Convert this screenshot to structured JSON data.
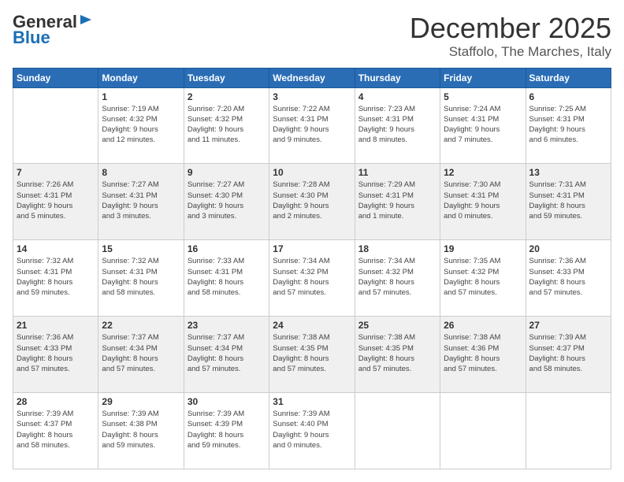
{
  "logo": {
    "general": "General",
    "blue": "Blue"
  },
  "header": {
    "month": "December 2025",
    "location": "Staffolo, The Marches, Italy"
  },
  "weekdays": [
    "Sunday",
    "Monday",
    "Tuesday",
    "Wednesday",
    "Thursday",
    "Friday",
    "Saturday"
  ],
  "weeks": [
    [
      {
        "day": "",
        "detail": ""
      },
      {
        "day": "1",
        "detail": "Sunrise: 7:19 AM\nSunset: 4:32 PM\nDaylight: 9 hours\nand 12 minutes."
      },
      {
        "day": "2",
        "detail": "Sunrise: 7:20 AM\nSunset: 4:32 PM\nDaylight: 9 hours\nand 11 minutes."
      },
      {
        "day": "3",
        "detail": "Sunrise: 7:22 AM\nSunset: 4:31 PM\nDaylight: 9 hours\nand 9 minutes."
      },
      {
        "day": "4",
        "detail": "Sunrise: 7:23 AM\nSunset: 4:31 PM\nDaylight: 9 hours\nand 8 minutes."
      },
      {
        "day": "5",
        "detail": "Sunrise: 7:24 AM\nSunset: 4:31 PM\nDaylight: 9 hours\nand 7 minutes."
      },
      {
        "day": "6",
        "detail": "Sunrise: 7:25 AM\nSunset: 4:31 PM\nDaylight: 9 hours\nand 6 minutes."
      }
    ],
    [
      {
        "day": "7",
        "detail": "Sunrise: 7:26 AM\nSunset: 4:31 PM\nDaylight: 9 hours\nand 5 minutes."
      },
      {
        "day": "8",
        "detail": "Sunrise: 7:27 AM\nSunset: 4:31 PM\nDaylight: 9 hours\nand 3 minutes."
      },
      {
        "day": "9",
        "detail": "Sunrise: 7:27 AM\nSunset: 4:30 PM\nDaylight: 9 hours\nand 3 minutes."
      },
      {
        "day": "10",
        "detail": "Sunrise: 7:28 AM\nSunset: 4:30 PM\nDaylight: 9 hours\nand 2 minutes."
      },
      {
        "day": "11",
        "detail": "Sunrise: 7:29 AM\nSunset: 4:31 PM\nDaylight: 9 hours\nand 1 minute."
      },
      {
        "day": "12",
        "detail": "Sunrise: 7:30 AM\nSunset: 4:31 PM\nDaylight: 9 hours\nand 0 minutes."
      },
      {
        "day": "13",
        "detail": "Sunrise: 7:31 AM\nSunset: 4:31 PM\nDaylight: 8 hours\nand 59 minutes."
      }
    ],
    [
      {
        "day": "14",
        "detail": "Sunrise: 7:32 AM\nSunset: 4:31 PM\nDaylight: 8 hours\nand 59 minutes."
      },
      {
        "day": "15",
        "detail": "Sunrise: 7:32 AM\nSunset: 4:31 PM\nDaylight: 8 hours\nand 58 minutes."
      },
      {
        "day": "16",
        "detail": "Sunrise: 7:33 AM\nSunset: 4:31 PM\nDaylight: 8 hours\nand 58 minutes."
      },
      {
        "day": "17",
        "detail": "Sunrise: 7:34 AM\nSunset: 4:32 PM\nDaylight: 8 hours\nand 57 minutes."
      },
      {
        "day": "18",
        "detail": "Sunrise: 7:34 AM\nSunset: 4:32 PM\nDaylight: 8 hours\nand 57 minutes."
      },
      {
        "day": "19",
        "detail": "Sunrise: 7:35 AM\nSunset: 4:32 PM\nDaylight: 8 hours\nand 57 minutes."
      },
      {
        "day": "20",
        "detail": "Sunrise: 7:36 AM\nSunset: 4:33 PM\nDaylight: 8 hours\nand 57 minutes."
      }
    ],
    [
      {
        "day": "21",
        "detail": "Sunrise: 7:36 AM\nSunset: 4:33 PM\nDaylight: 8 hours\nand 57 minutes."
      },
      {
        "day": "22",
        "detail": "Sunrise: 7:37 AM\nSunset: 4:34 PM\nDaylight: 8 hours\nand 57 minutes."
      },
      {
        "day": "23",
        "detail": "Sunrise: 7:37 AM\nSunset: 4:34 PM\nDaylight: 8 hours\nand 57 minutes."
      },
      {
        "day": "24",
        "detail": "Sunrise: 7:38 AM\nSunset: 4:35 PM\nDaylight: 8 hours\nand 57 minutes."
      },
      {
        "day": "25",
        "detail": "Sunrise: 7:38 AM\nSunset: 4:35 PM\nDaylight: 8 hours\nand 57 minutes."
      },
      {
        "day": "26",
        "detail": "Sunrise: 7:38 AM\nSunset: 4:36 PM\nDaylight: 8 hours\nand 57 minutes."
      },
      {
        "day": "27",
        "detail": "Sunrise: 7:39 AM\nSunset: 4:37 PM\nDaylight: 8 hours\nand 58 minutes."
      }
    ],
    [
      {
        "day": "28",
        "detail": "Sunrise: 7:39 AM\nSunset: 4:37 PM\nDaylight: 8 hours\nand 58 minutes."
      },
      {
        "day": "29",
        "detail": "Sunrise: 7:39 AM\nSunset: 4:38 PM\nDaylight: 8 hours\nand 59 minutes."
      },
      {
        "day": "30",
        "detail": "Sunrise: 7:39 AM\nSunset: 4:39 PM\nDaylight: 8 hours\nand 59 minutes."
      },
      {
        "day": "31",
        "detail": "Sunrise: 7:39 AM\nSunset: 4:40 PM\nDaylight: 9 hours\nand 0 minutes."
      },
      {
        "day": "",
        "detail": ""
      },
      {
        "day": "",
        "detail": ""
      },
      {
        "day": "",
        "detail": ""
      }
    ]
  ]
}
